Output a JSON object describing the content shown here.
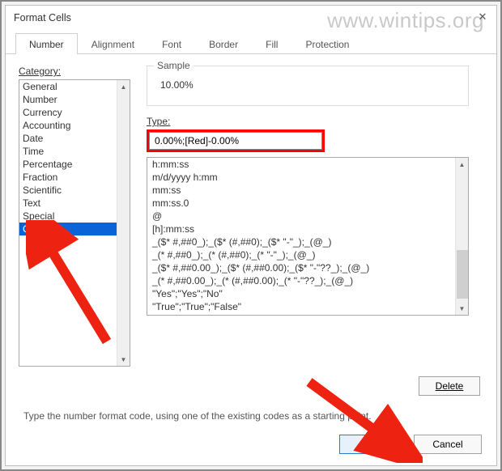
{
  "watermark": "www.wintips.org",
  "dialog": {
    "title": "Format Cells",
    "close_glyph": "✕"
  },
  "tabs": {
    "number": "Number",
    "alignment": "Alignment",
    "font": "Font",
    "border": "Border",
    "fill": "Fill",
    "protection": "Protection"
  },
  "category": {
    "label": "Category:",
    "items": [
      "General",
      "Number",
      "Currency",
      "Accounting",
      "Date",
      "Time",
      "Percentage",
      "Fraction",
      "Scientific",
      "Text",
      "Special",
      "Custom"
    ],
    "selected": "Custom"
  },
  "sample": {
    "label": "Sample",
    "value": "10.00%"
  },
  "type": {
    "label": "Type:",
    "value": "0.00%;[Red]-0.00%"
  },
  "formats": [
    "h:mm:ss",
    "m/d/yyyy h:mm",
    "mm:ss",
    "mm:ss.0",
    "@",
    "[h]:mm:ss",
    "_($* #,##0_);_($* (#,##0);_($* \"-\"_);_(@_)",
    "_(* #,##0_);_(* (#,##0);_(* \"-\"_);_(@_)",
    "_($* #,##0.00_);_($* (#,##0.00);_($* \"-\"??_);_(@_)",
    "_(* #,##0.00_);_(* (#,##0.00);_(* \"-\"??_);_(@_)",
    "\"Yes\";\"Yes\";\"No\"",
    "\"True\";\"True\";\"False\""
  ],
  "buttons": {
    "delete": "Delete",
    "ok": "OK",
    "cancel": "Cancel"
  },
  "hint": "Type the number format code, using one of the existing codes as a starting point."
}
